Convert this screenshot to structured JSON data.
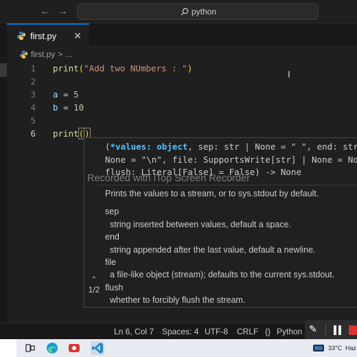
{
  "titlebar": {
    "back_icon": "arrow-left-icon",
    "forward_icon": "arrow-right-icon",
    "search_text": "python"
  },
  "tab": {
    "filename": "first.py",
    "close_icon": "close-icon"
  },
  "breadcrumb": {
    "file": "first.py",
    "separator": ">",
    "rest": "..."
  },
  "editor": {
    "line_numbers": [
      "1",
      "2",
      "3",
      "4",
      "5",
      "6"
    ],
    "active_line": 6
  },
  "signature_help": {
    "line1_param": "*values: object",
    "line1_rest": ", sep: str | None = \" \", end: str | ",
    "line1_open": "(",
    "line2": "None = \"\\n\", file: SupportsWrite[str] | None = None,",
    "line3": "flush: Literal[False] = False) -> None",
    "description": "Prints the values to a stream, or to sys.stdout by default.",
    "params": [
      {
        "name": "sep",
        "desc": "string inserted between values, default a space."
      },
      {
        "name": "end",
        "desc": "string appended after the last value, default a newline."
      },
      {
        "name": "file",
        "desc": "a file-like object (stream); defaults to the current sys.stdout."
      },
      {
        "name": "flush",
        "desc": "whether to forcibly flush the stream."
      }
    ],
    "counter": "1/2"
  },
  "watermark": "Recorded with iTop Screen Recorder",
  "statusbar": {
    "position": "Ln 6, Col 7",
    "spaces": "Spaces: 4",
    "encoding": "UTF-8",
    "eol": "CRLF",
    "language": "Python"
  },
  "taskbar": {
    "temperature": "33°C",
    "label": "Haz"
  },
  "colors": {
    "accent": "#0078d4",
    "record_stop": "#e03030"
  }
}
